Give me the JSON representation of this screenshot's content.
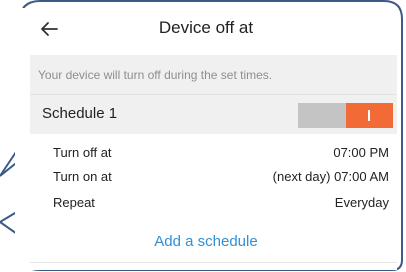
{
  "header": {
    "title": "Device off at",
    "back_icon": "arrow-left-icon"
  },
  "notice": {
    "text": "Your device will turn off during the set times."
  },
  "schedule": {
    "name": "Schedule 1",
    "enabled": true,
    "toggle_on_color": "#f26a36",
    "toggle_off_color": "#c4c4c4",
    "rows": [
      {
        "label": "Turn off at",
        "value": "07:00 PM"
      },
      {
        "label": "Turn on at",
        "value": "(next day) 07:00 AM"
      },
      {
        "label": "Repeat",
        "value": "Everyday"
      }
    ]
  },
  "add_schedule_label": "Add a schedule",
  "colors": {
    "accent": "#2f8fd8",
    "callout_stroke": "#3b5a87"
  }
}
